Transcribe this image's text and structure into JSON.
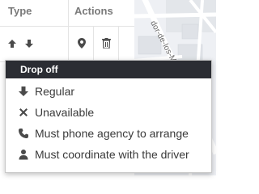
{
  "table": {
    "header_type": "Type",
    "header_actions": "Actions"
  },
  "map": {
    "street_label": "dor-de-los-Mor"
  },
  "dropdown": {
    "title": "Drop off",
    "items": [
      {
        "label": "Regular",
        "icon": "arrow-down-icon"
      },
      {
        "label": "Unavailable",
        "icon": "x-icon"
      },
      {
        "label": "Must phone agency to arrange",
        "icon": "phone-icon"
      },
      {
        "label": "Must coordinate with the driver",
        "icon": "person-icon"
      }
    ]
  },
  "colors": {
    "menu_header_bg": "#2b2d33",
    "text": "#3a3a3a",
    "header_text": "#7a7a7a"
  }
}
